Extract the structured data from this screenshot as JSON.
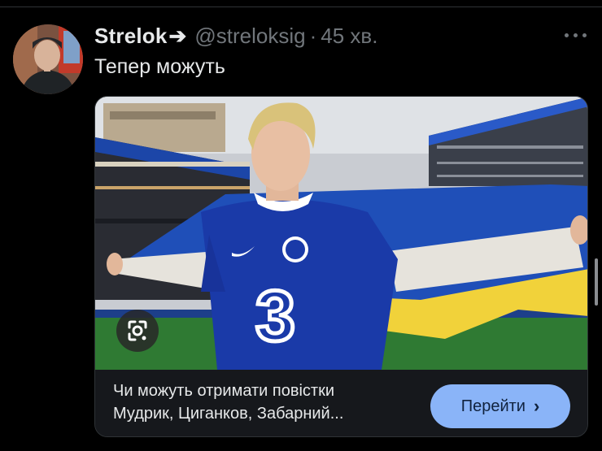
{
  "tweet": {
    "author_name": "Strelok",
    "author_arrow": "➔",
    "handle": "@streloksig",
    "separator": "·",
    "time_ago": "45 хв.",
    "text": "Тепер можуть"
  },
  "link_card": {
    "title_line1": "Чи можуть отримати повістки",
    "title_line2": "Мудрик, Циганков, Забарний...",
    "button_label": "Перейти",
    "button_chevron": "›",
    "jersey_number": "3"
  },
  "icons": {
    "more": "more-horizontal-icon",
    "lens": "google-lens-icon"
  },
  "colors": {
    "background": "#000000",
    "text_primary": "#e7e9ea",
    "text_secondary": "#71767b",
    "button_bg": "#8ab4f8",
    "flag_blue": "#1f4fb8",
    "flag_yellow": "#f1d23a",
    "jersey_blue": "#1a3aa8"
  }
}
